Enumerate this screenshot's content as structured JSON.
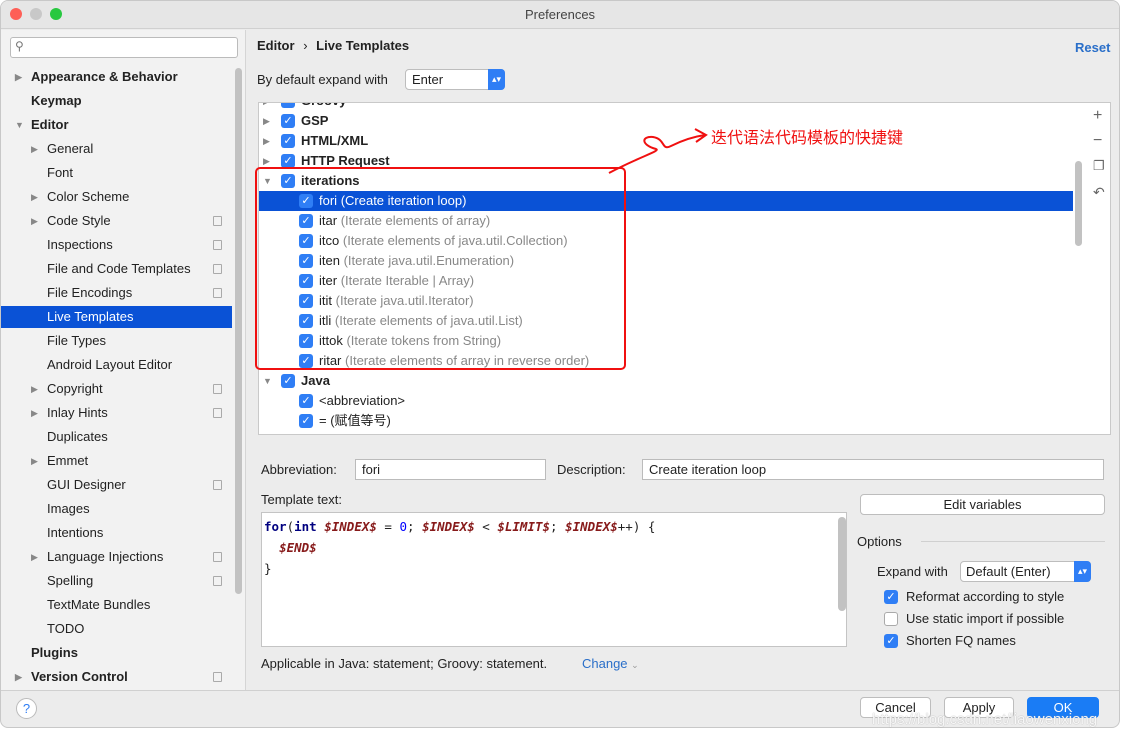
{
  "window": {
    "title": "Preferences"
  },
  "search": {
    "placeholder": ""
  },
  "sidebar": {
    "items": [
      {
        "label": "Appearance & Behavior",
        "level": 0,
        "bold": true,
        "arrow": "right"
      },
      {
        "label": "Keymap",
        "level": 0,
        "bold": true
      },
      {
        "label": "Editor",
        "level": 0,
        "bold": true,
        "arrow": "down"
      },
      {
        "label": "General",
        "level": 1,
        "arrow": "right"
      },
      {
        "label": "Font",
        "level": 1
      },
      {
        "label": "Color Scheme",
        "level": 1,
        "arrow": "right"
      },
      {
        "label": "Code Style",
        "level": 1,
        "arrow": "right",
        "copy": true
      },
      {
        "label": "Inspections",
        "level": 1,
        "copy": true
      },
      {
        "label": "File and Code Templates",
        "level": 1,
        "copy": true
      },
      {
        "label": "File Encodings",
        "level": 1,
        "copy": true
      },
      {
        "label": "Live Templates",
        "level": 1,
        "selected": true
      },
      {
        "label": "File Types",
        "level": 1
      },
      {
        "label": "Android Layout Editor",
        "level": 1
      },
      {
        "label": "Copyright",
        "level": 1,
        "arrow": "right",
        "copy": true
      },
      {
        "label": "Inlay Hints",
        "level": 1,
        "arrow": "right",
        "copy": true
      },
      {
        "label": "Duplicates",
        "level": 1
      },
      {
        "label": "Emmet",
        "level": 1,
        "arrow": "right"
      },
      {
        "label": "GUI Designer",
        "level": 1,
        "copy": true
      },
      {
        "label": "Images",
        "level": 1
      },
      {
        "label": "Intentions",
        "level": 1
      },
      {
        "label": "Language Injections",
        "level": 1,
        "arrow": "right",
        "copy": true
      },
      {
        "label": "Spelling",
        "level": 1,
        "copy": true
      },
      {
        "label": "TextMate Bundles",
        "level": 1
      },
      {
        "label": "TODO",
        "level": 1
      },
      {
        "label": "Plugins",
        "level": 0,
        "bold": true
      },
      {
        "label": "Version Control",
        "level": 0,
        "bold": true,
        "arrow": "right",
        "copy": true
      }
    ]
  },
  "breadcrumb": {
    "parent": "Editor",
    "sep": "›",
    "current": "Live Templates"
  },
  "reset_label": "Reset",
  "expand": {
    "label": "By default expand with",
    "value": "Enter"
  },
  "tree": [
    {
      "name": "Groovy",
      "level": 0,
      "arrow": "right"
    },
    {
      "name": "GSP",
      "level": 0,
      "arrow": "right"
    },
    {
      "name": "HTML/XML",
      "level": 0,
      "arrow": "right"
    },
    {
      "name": "HTTP Request",
      "level": 0,
      "arrow": "right"
    },
    {
      "name": "iterations",
      "level": 0,
      "arrow": "down"
    },
    {
      "name": "fori",
      "desc": "(Create iteration loop)",
      "level": 1,
      "selected": true
    },
    {
      "name": "itar",
      "desc": "(Iterate elements of array)",
      "level": 1
    },
    {
      "name": "itco",
      "desc": "(Iterate elements of java.util.Collection)",
      "level": 1
    },
    {
      "name": "iten",
      "desc": "(Iterate java.util.Enumeration)",
      "level": 1
    },
    {
      "name": "iter",
      "desc": "(Iterate Iterable | Array)",
      "level": 1
    },
    {
      "name": "itit",
      "desc": "(Iterate java.util.Iterator)",
      "level": 1
    },
    {
      "name": "itli",
      "desc": "(Iterate elements of java.util.List)",
      "level": 1
    },
    {
      "name": "ittok",
      "desc": "(Iterate tokens from String)",
      "level": 1
    },
    {
      "name": "ritar",
      "desc": "(Iterate elements of array in reverse order)",
      "level": 1
    },
    {
      "name": "Java",
      "level": 0,
      "arrow": "down"
    },
    {
      "name": "<abbreviation>",
      "level": 1
    },
    {
      "name": "= (赋值等号)",
      "level": 1
    }
  ],
  "annotation": {
    "text": "迭代语法代码模板的快捷键",
    "color": "#f01010"
  },
  "abbreviation": {
    "label": "Abbreviation:",
    "value": "fori"
  },
  "description": {
    "label": "Description:",
    "value": "Create iteration loop"
  },
  "template_text": {
    "label": "Template text:"
  },
  "edit_variables_label": "Edit variables",
  "options": {
    "title": "Options",
    "expand_label": "Expand with",
    "expand_value": "Default (Enter)",
    "checks": [
      {
        "label": "Reformat according to style",
        "checked": true
      },
      {
        "label": "Use static import if possible",
        "checked": false
      },
      {
        "label": "Shorten FQ names",
        "checked": true
      }
    ]
  },
  "applicable": {
    "text": "Applicable in Java: statement; Groovy: statement.",
    "change": "Change"
  },
  "buttons": {
    "cancel": "Cancel",
    "apply": "Apply",
    "ok": "OK",
    "help": "?"
  },
  "watermark": "https://blog.csdn.net/liaowenxiong",
  "colors": {
    "accent": "#0a52d6",
    "checkbox": "#2f7ef5",
    "ok": "#1a7cf5"
  }
}
